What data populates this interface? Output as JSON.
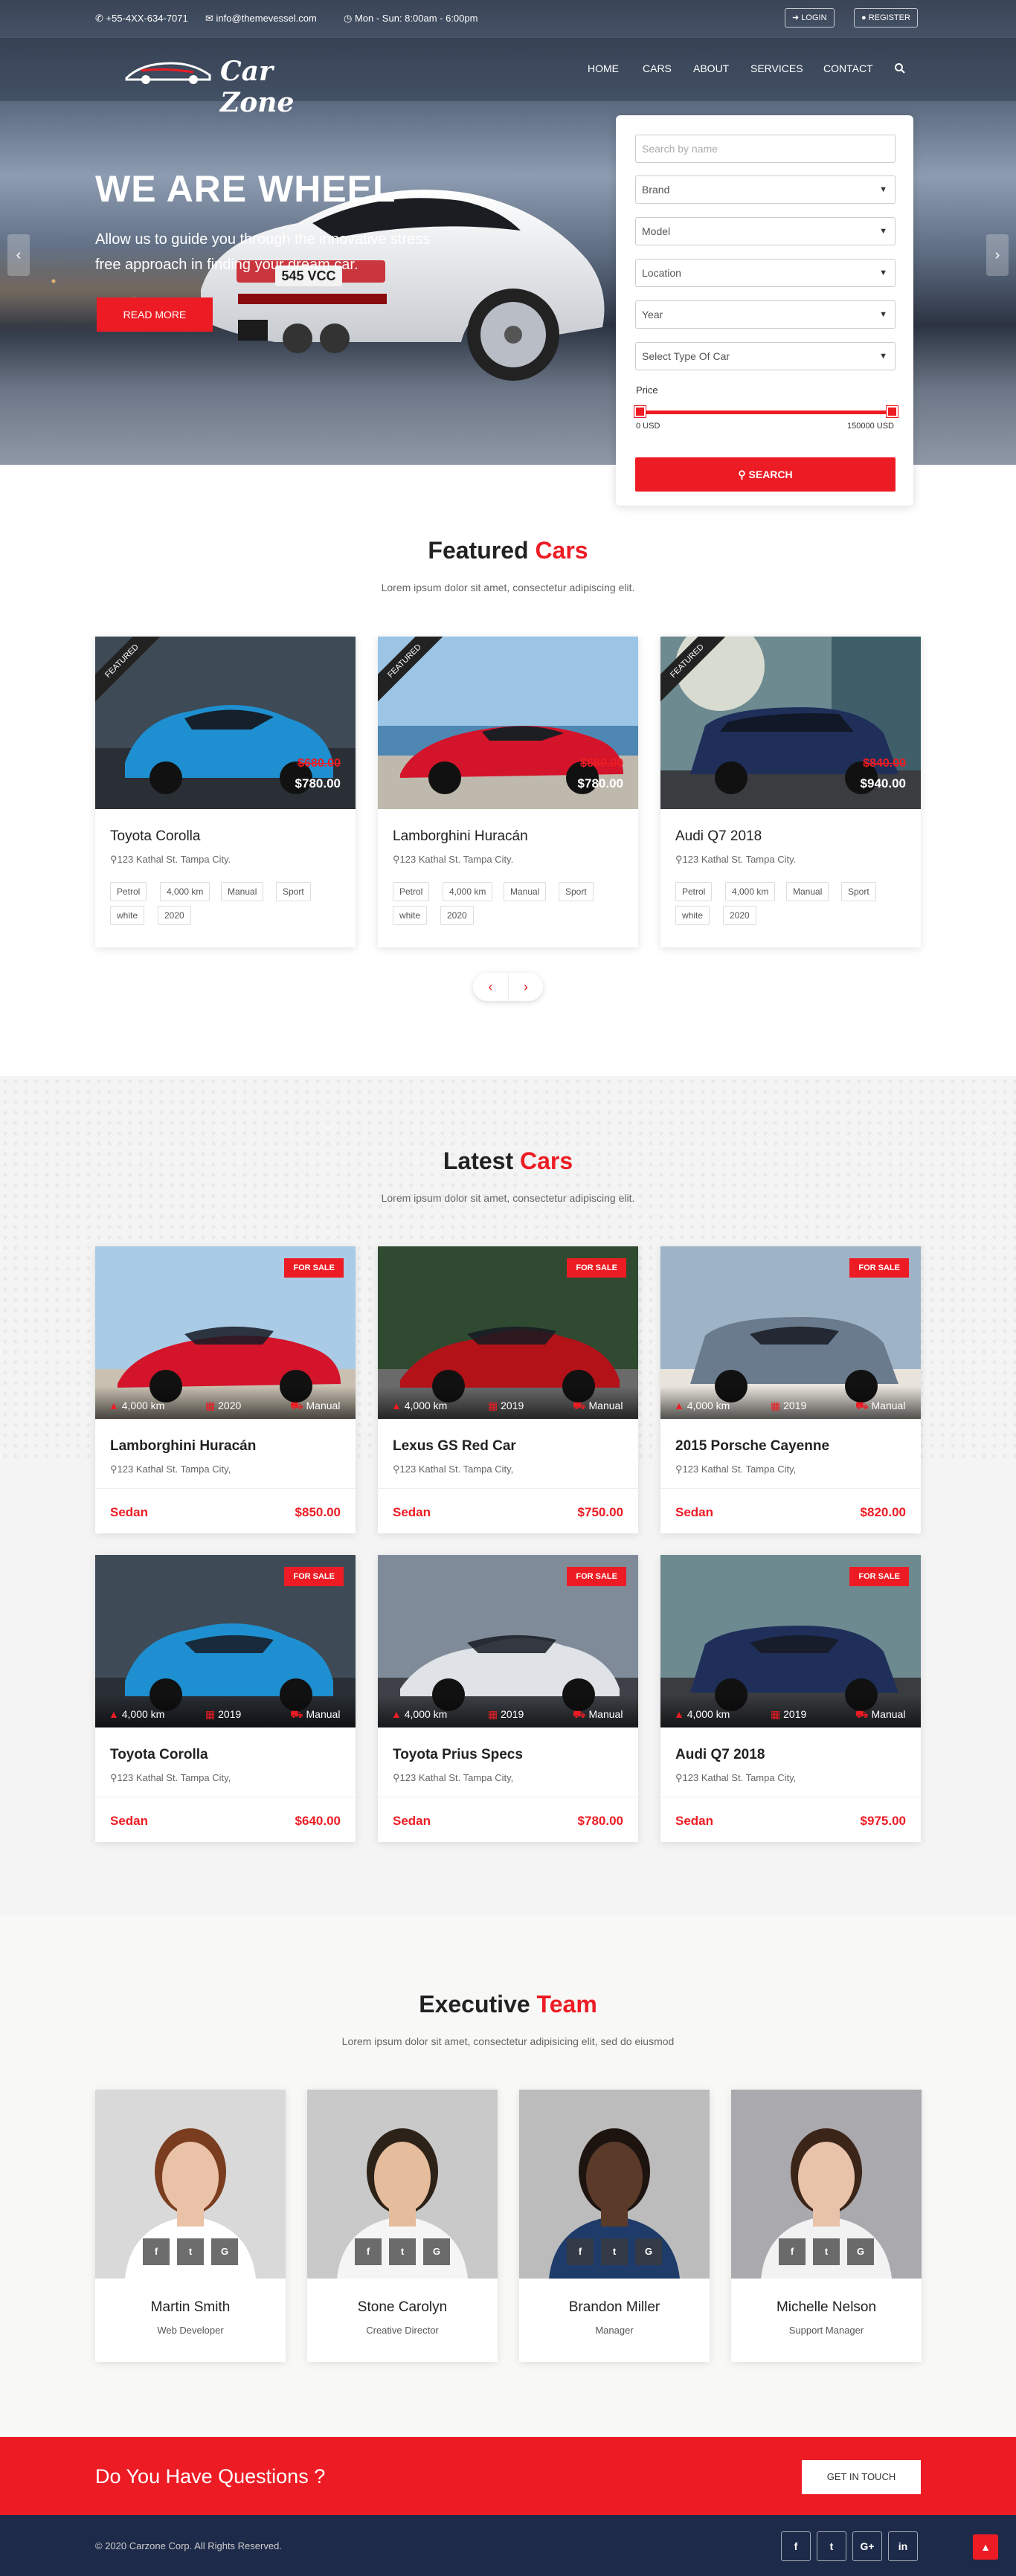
{
  "topbar": {
    "phone": "+55-4XX-634-7071",
    "email": "info@themevessel.com",
    "hours": "Mon - Sun: 8:00am - 6:00pm",
    "login": "LOGIN",
    "register": "REGISTER"
  },
  "logo": {
    "text": "Car Zone"
  },
  "nav": [
    "HOME",
    "CARS",
    "ABOUT",
    "SERVICES",
    "CONTACT"
  ],
  "hero": {
    "title": "WE ARE WHEEL",
    "text": "Allow us to guide you through the innovative stress free approach in finding your dream car.",
    "button": "READ MORE",
    "plate": "545 VCC"
  },
  "search_panel": {
    "name_placeholder": "Search by name",
    "selects": [
      "Brand",
      "Model",
      "Location",
      "Year",
      "Select Type Of Car"
    ],
    "price_label": "Price",
    "price_min": "0 USD",
    "price_max": "150000 USD",
    "button": "SEARCH"
  },
  "featured": {
    "title": "Featured",
    "title_accent": "Cars",
    "subtitle": "Lorem ipsum dolor sit amet, consectetur adipiscing elit.",
    "ribbon": "FEATURED",
    "cards": [
      {
        "name": "Toyota Corolla",
        "address": "123 Kathal St. Tampa City.",
        "old_price": "$680.00",
        "price": "$780.00",
        "tags": [
          "Petrol",
          "4,000 km",
          "Manual",
          "Sport",
          "white",
          "2020"
        ]
      },
      {
        "name": "Lamborghini Huracán",
        "address": "123 Kathal St. Tampa City.",
        "old_price": "$680.00",
        "price": "$780.00",
        "tags": [
          "Petrol",
          "4,000 km",
          "Manual",
          "Sport",
          "white",
          "2020"
        ]
      },
      {
        "name": "Audi Q7 2018",
        "address": "123 Kathal St. Tampa City.",
        "old_price": "$840.00",
        "price": "$940.00",
        "tags": [
          "Petrol",
          "4,000 km",
          "Manual",
          "Sport",
          "white",
          "2020"
        ]
      }
    ]
  },
  "latest": {
    "title": "Latest",
    "title_accent": "Cars",
    "subtitle": "Lorem ipsum dolor sit amet, consectetur adipiscing elit.",
    "badge": "FOR SALE",
    "cards": [
      {
        "name": "Lamborghini Huracán",
        "address": "123 Kathal St. Tampa City,",
        "km": "4,000 km",
        "year": "2020",
        "trans": "Manual",
        "type": "Sedan",
        "price": "$850.00"
      },
      {
        "name": "Lexus GS Red Car",
        "address": "123 Kathal St. Tampa City,",
        "km": "4,000 km",
        "year": "2019",
        "trans": "Manual",
        "type": "Sedan",
        "price": "$750.00"
      },
      {
        "name": "2015 Porsche Cayenne",
        "address": "123 Kathal St. Tampa City,",
        "km": "4,000 km",
        "year": "2019",
        "trans": "Manual",
        "type": "Sedan",
        "price": "$820.00"
      },
      {
        "name": "Toyota Corolla",
        "address": "123 Kathal St. Tampa City,",
        "km": "4,000 km",
        "year": "2019",
        "trans": "Manual",
        "type": "Sedan",
        "price": "$640.00"
      },
      {
        "name": "Toyota Prius Specs",
        "address": "123 Kathal St. Tampa City,",
        "km": "4,000 km",
        "year": "2019",
        "trans": "Manual",
        "type": "Sedan",
        "price": "$780.00"
      },
      {
        "name": "Audi Q7 2018",
        "address": "123 Kathal St. Tampa City,",
        "km": "4,000 km",
        "year": "2019",
        "trans": "Manual",
        "type": "Sedan",
        "price": "$975.00"
      }
    ]
  },
  "team": {
    "title": "Executive",
    "title_accent": "Team",
    "subtitle": "Lorem ipsum dolor sit amet, consectetur adipisicing elit, sed do eiusmod",
    "social": [
      "f",
      "t",
      "G"
    ],
    "members": [
      {
        "name": "Martin Smith",
        "role": "Web Developer"
      },
      {
        "name": "Stone Carolyn",
        "role": "Creative Director"
      },
      {
        "name": "Brandon Miller",
        "role": "Manager"
      },
      {
        "name": "Michelle Nelson",
        "role": "Support Manager"
      }
    ]
  },
  "cta": {
    "text": "Do You Have Questions ?",
    "button": "GET IN TOUCH"
  },
  "footer": {
    "copyright": "© 2020 Carzone Corp. All Rights Reserved.",
    "social": [
      "f",
      "t",
      "G+",
      "in"
    ]
  },
  "colors": {
    "accent": "#ed1c24",
    "footer": "#1e2a4a",
    "section_gray": "#f4f4f4"
  }
}
